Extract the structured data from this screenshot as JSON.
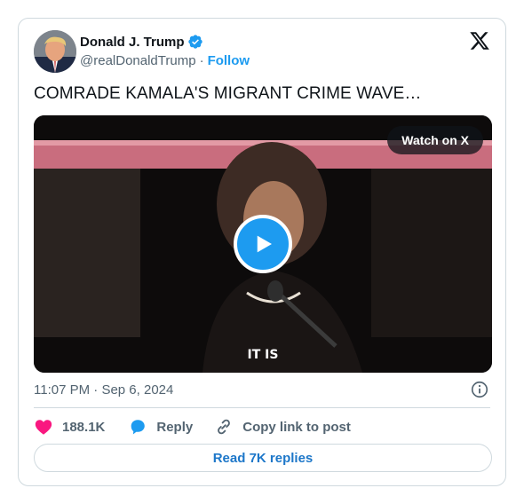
{
  "author": {
    "name": "Donald J. Trump",
    "handle": "@realDonaldTrump",
    "separator": "·",
    "follow_label": "Follow",
    "verified_icon": "verified-badge-icon",
    "verified_color": "#1d9bf0"
  },
  "platform_icon": "x-logo-icon",
  "tweet": {
    "text": "COMRADE KAMALA'S MIGRANT CRIME WAVE…"
  },
  "media": {
    "watch_label": "Watch on X",
    "caption": "IT IS",
    "play_icon": "play-icon"
  },
  "timestamp": {
    "time": "11:07 PM",
    "separator": "·",
    "date": "Sep 6, 2024"
  },
  "actions": {
    "likes_count": "188.1K",
    "reply_label": "Reply",
    "copy_label": "Copy link to post"
  },
  "read_replies_label": "Read 7K replies",
  "colors": {
    "accent": "#1d9bf0",
    "like": "#f91880",
    "text": "#0f1419",
    "muted": "#536471",
    "border": "#cfd9de"
  }
}
